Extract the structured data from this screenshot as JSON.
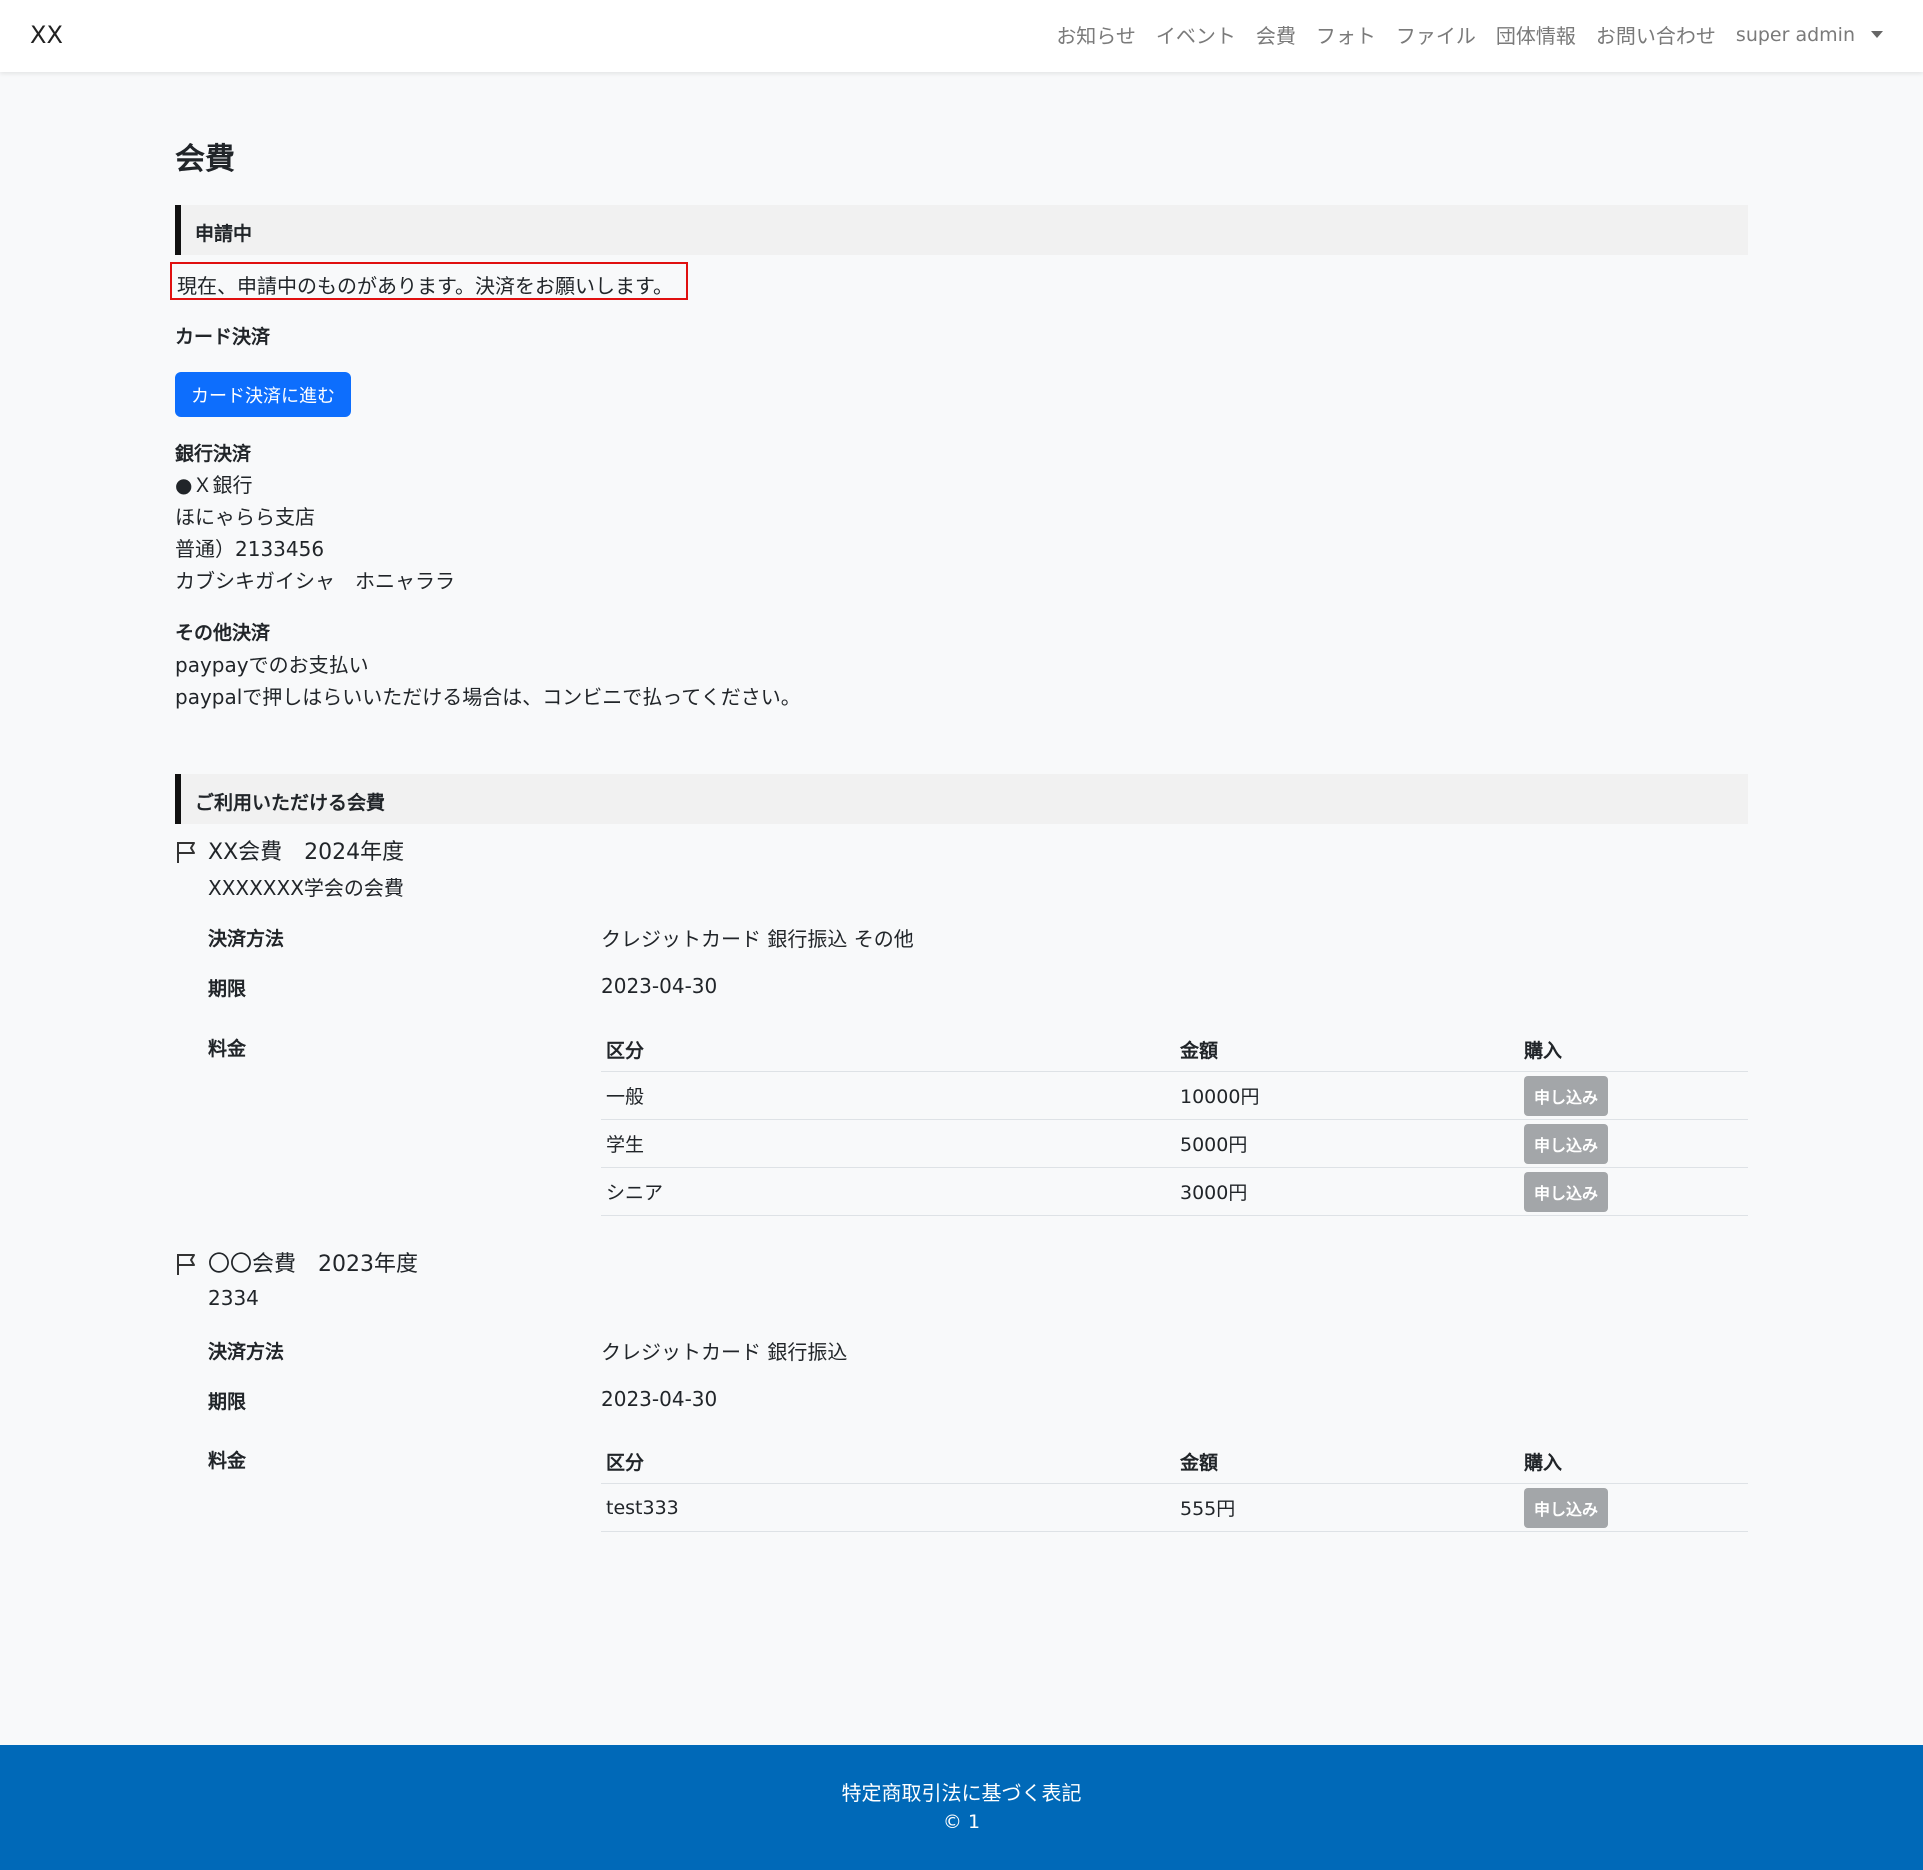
{
  "navbar": {
    "brand": "XX",
    "links": [
      "お知らせ",
      "イベント",
      "会費",
      "フォト",
      "ファイル",
      "団体情報",
      "お問い合わせ"
    ],
    "user": "super admin",
    "user_icon": "caret-down-icon"
  },
  "page": {
    "title": "会費"
  },
  "pending": {
    "header": "申請中",
    "message": "現在、申請中のものがあります。決済をお願いします。",
    "card_heading": "カード決済",
    "card_button": "カード決済に進む",
    "bank_heading": "銀行決済",
    "bank_lines": [
      "●Ｘ銀行",
      "ほにゃらら支店",
      "普通）2133456",
      "カブシキガイシャ　ホニャララ"
    ],
    "other_heading": "その他決済",
    "other_lines": [
      "paypayでのお支払い",
      "paypalで押しはらいいただける場合は、コンビニで払ってください。"
    ]
  },
  "available": {
    "header": "ご利用いただける会費",
    "items": [
      {
        "icon": "flag-icon",
        "title": "XX会費　2024年度",
        "description": "XXXXXXX学会の会費",
        "method_label": "決済方法",
        "method_value": "クレジットカード 銀行振込 その他",
        "deadline_label": "期限",
        "deadline_value": "2023-04-30",
        "fee_label": "料金",
        "columns": [
          "区分",
          "金額",
          "購入"
        ],
        "rows": [
          {
            "kubun": "一般",
            "kingaku": "10000円",
            "button": "申し込み"
          },
          {
            "kubun": "学生",
            "kingaku": "5000円",
            "button": "申し込み"
          },
          {
            "kubun": "シニア",
            "kingaku": "3000円",
            "button": "申し込み"
          }
        ]
      },
      {
        "icon": "flag-icon",
        "title": "〇〇会費　2023年度",
        "description": "2334",
        "method_label": "決済方法",
        "method_value": "クレジットカード 銀行振込",
        "deadline_label": "期限",
        "deadline_value": "2023-04-30",
        "fee_label": "料金",
        "columns": [
          "区分",
          "金額",
          "購入"
        ],
        "rows": [
          {
            "kubun": "test333",
            "kingaku": "555円",
            "button": "申し込み"
          }
        ]
      }
    ]
  },
  "footer": {
    "link": "特定商取引法に基づく表記",
    "copyright": "© 1"
  },
  "colors": {
    "primary": "#0d6efd",
    "footer": "#0069b8",
    "alert_border": "#e01010",
    "button_disabled": "#a3a6a9"
  }
}
